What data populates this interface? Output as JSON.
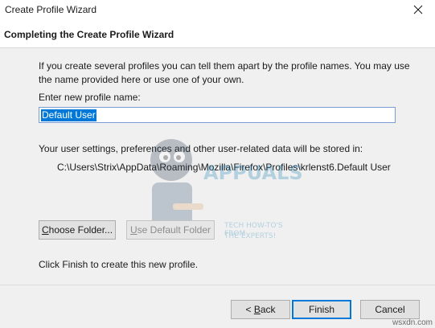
{
  "window": {
    "title": "Create Profile Wizard"
  },
  "header": {
    "title": "Completing the Create Profile Wizard"
  },
  "content": {
    "intro": "If you create several profiles you can tell them apart by the profile names. You may use the name provided here or use one of your own.",
    "name_label": "Enter new profile name:",
    "name_value": "Default User",
    "storage_label": "Your user settings, preferences and other user-related data will be stored in:",
    "storage_path": "C:\\Users\\Strix\\AppData\\Roaming\\Mozilla\\Firefox\\Profiles\\krlenst6.Default User",
    "choose_folder_prefix": "C",
    "choose_folder_rest": "hoose Folder...",
    "use_default_prefix": "U",
    "use_default_rest": "se Default Folder",
    "finish_hint": "Click Finish to create this new profile."
  },
  "footer": {
    "back_prefix": "< ",
    "back_accel": "B",
    "back_rest": "ack",
    "finish_label": "Finish",
    "cancel_label": "Cancel"
  },
  "watermark": {
    "brand": "APPUALS",
    "tagline_1": "TECH HOW-TO'S FROM",
    "tagline_2": "THE EXPERTS!"
  },
  "site_tag": "wsxdn.com",
  "colors": {
    "content_bg": "#f0f0f0",
    "selection": "#0078d7",
    "input_border": "#7a9cd3"
  }
}
